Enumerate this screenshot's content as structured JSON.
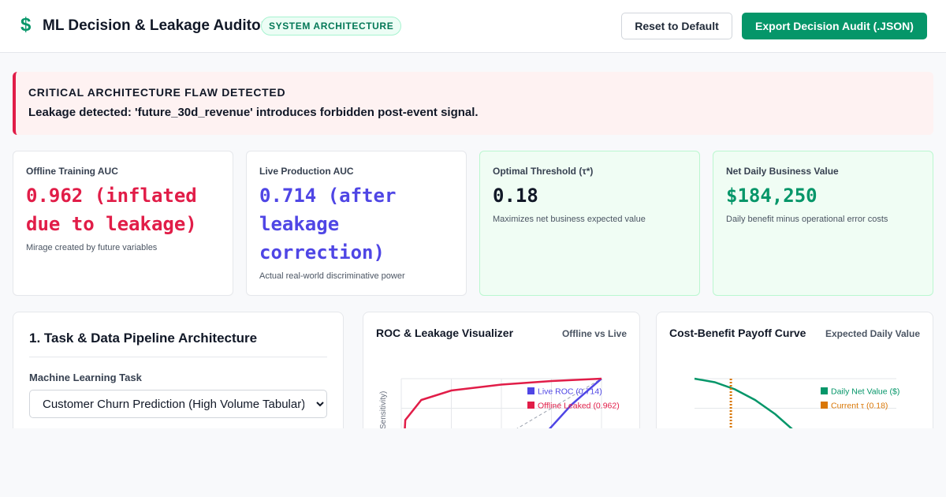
{
  "header": {
    "logo_icon": "$",
    "title": "ML Decision & Leakage Auditor",
    "badge": "SYSTEM ARCHITECTURE",
    "reset_label": "Reset to Default",
    "export_label": "Export Decision Audit (.JSON)"
  },
  "alert": {
    "title": "CRITICAL ARCHITECTURE FLAW DETECTED",
    "message": "Leakage detected: 'future_30d_revenue' introduces forbidden post-event signal."
  },
  "metrics": [
    {
      "label": "Offline Training AUC",
      "value": "0.962 (inflated due to leakage)",
      "sub": "Mirage created by future variables",
      "color": "#e11d48"
    },
    {
      "label": "Live Production AUC",
      "value": "0.714 (after leakage correction)",
      "sub": "Actual real-world discriminative power",
      "color": "#4f46e5"
    },
    {
      "label": "Optimal Threshold (τ*)",
      "value": "0.18",
      "sub": "Maximizes net business expected value",
      "color": "#111827"
    },
    {
      "label": "Net Daily Business Value",
      "value": "$184,250",
      "sub": "Daily benefit minus operational error costs",
      "color": "#059669"
    }
  ],
  "pipeline": {
    "title": "1. Task & Data Pipeline Architecture",
    "task_label": "Machine Learning Task",
    "task_selected": "Customer Churn Prediction (High Volume Tabular)"
  },
  "roc_chart": {
    "title": "ROC & Leakage Visualizer",
    "subtitle": "Offline vs Live",
    "y_axis_label": "Sensitivity)"
  },
  "payoff_chart": {
    "title": "Cost-Benefit Payoff Curve",
    "subtitle": "Expected Daily Value"
  },
  "chart_data": [
    {
      "type": "line",
      "title": "ROC & Leakage Visualizer",
      "ylabel": "Sensitivity)",
      "xlim": [
        0,
        1
      ],
      "ylim": [
        0,
        1
      ],
      "grid": true,
      "legend": "top-right",
      "series": [
        {
          "name": "Live ROC (0.714)",
          "color": "#4f46e5",
          "x": [
            0.26,
            0.4,
            0.55,
            0.7,
            0.85,
            1.0
          ],
          "y": [
            0.0,
            0.1,
            0.26,
            0.5,
            0.78,
            1.0
          ]
        },
        {
          "name": "Offline Leaked (0.962)",
          "color": "#e11d48",
          "x": [
            0.0,
            0.02,
            0.1,
            0.25,
            0.5,
            0.75,
            1.0
          ],
          "y": [
            0.0,
            0.65,
            0.82,
            0.9,
            0.95,
            0.98,
            1.0
          ]
        }
      ]
    },
    {
      "type": "line",
      "title": "Cost-Benefit Payoff Curve",
      "grid": true,
      "legend": "top-right",
      "series": [
        {
          "name": "Daily Net Value ($)",
          "color": "#059669",
          "x": [
            0.0,
            0.1,
            0.2,
            0.3,
            0.4,
            0.5,
            0.6,
            0.7
          ],
          "y": [
            1.0,
            0.97,
            0.91,
            0.82,
            0.7,
            0.55,
            0.38,
            0.18
          ]
        },
        {
          "name": "Current τ (0.18)",
          "color": "#d97706",
          "x": [
            0.18,
            0.18
          ],
          "y": [
            0,
            1
          ]
        }
      ]
    }
  ]
}
